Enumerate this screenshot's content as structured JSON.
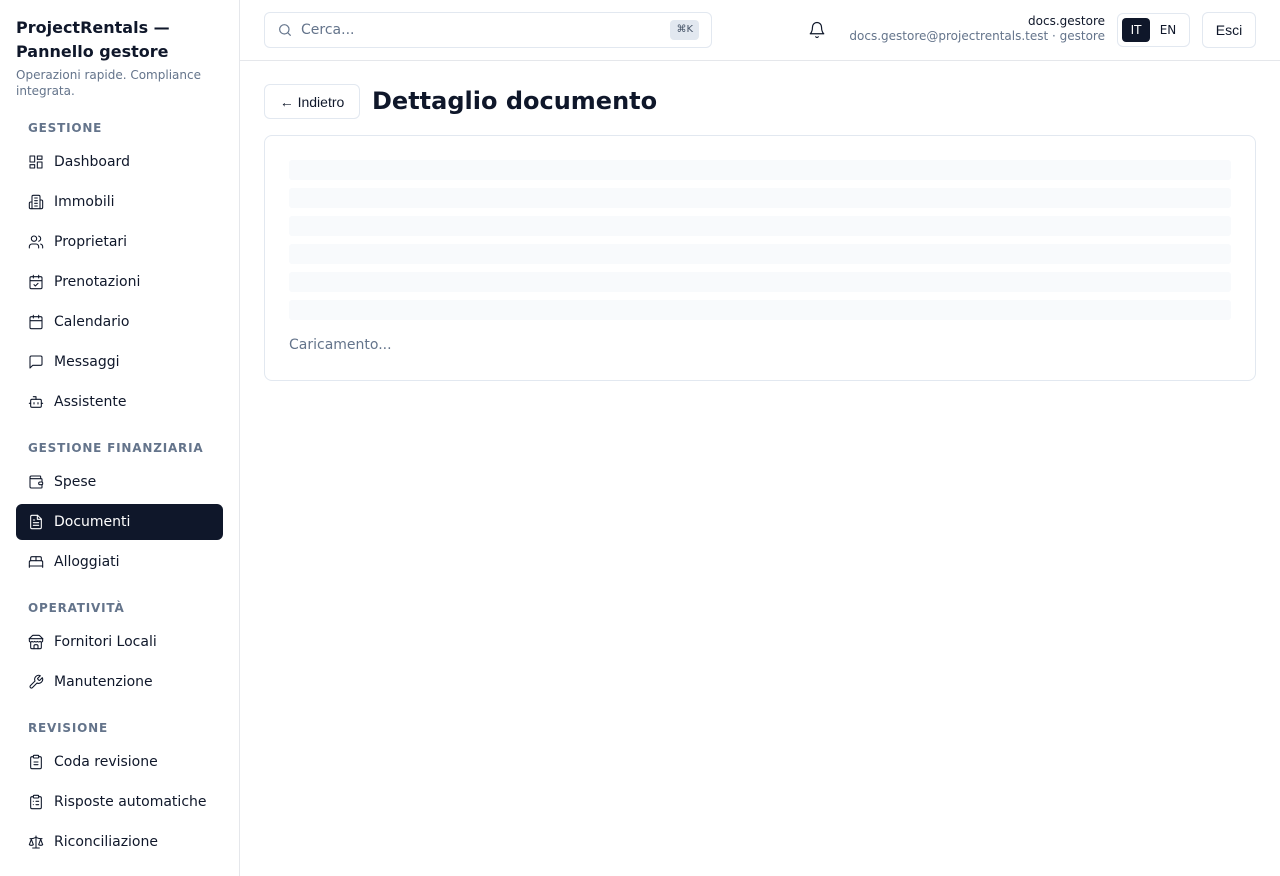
{
  "brand": {
    "title": "ProjectRentals — Pannello gestore",
    "subtitle": "Operazioni rapide. Compliance integrata."
  },
  "sidebar": {
    "sections": [
      {
        "label": "GESTIONE",
        "items": [
          {
            "label": "Dashboard",
            "icon": "dashboard-icon"
          },
          {
            "label": "Immobili",
            "icon": "building-icon"
          },
          {
            "label": "Proprietari",
            "icon": "users-icon"
          },
          {
            "label": "Prenotazioni",
            "icon": "calendar-check-icon"
          },
          {
            "label": "Calendario",
            "icon": "calendar-icon"
          },
          {
            "label": "Messaggi",
            "icon": "message-icon"
          },
          {
            "label": "Assistente",
            "icon": "bot-icon"
          }
        ]
      },
      {
        "label": "GESTIONE FINANZIARIA",
        "items": [
          {
            "label": "Spese",
            "icon": "wallet-icon"
          },
          {
            "label": "Documenti",
            "icon": "document-icon",
            "active": true
          },
          {
            "label": "Alloggiati",
            "icon": "bed-icon"
          }
        ]
      },
      {
        "label": "OPERATIVITÀ",
        "items": [
          {
            "label": "Fornitori Locali",
            "icon": "store-icon"
          },
          {
            "label": "Manutenzione",
            "icon": "wrench-icon"
          }
        ]
      },
      {
        "label": "REVISIONE",
        "items": [
          {
            "label": "Coda revisione",
            "icon": "clipboard-icon"
          },
          {
            "label": "Risposte automatiche",
            "icon": "clipboard-list-icon"
          },
          {
            "label": "Riconciliazione",
            "icon": "scale-icon"
          }
        ]
      }
    ]
  },
  "topbar": {
    "search_placeholder": "Cerca...",
    "search_shortcut": "⌘K",
    "user_name": "docs.gestore",
    "user_email": "docs.gestore@projectrentals.test · gestore",
    "lang_it": "IT",
    "lang_en": "EN",
    "lang_active": "IT",
    "logout_label": "Esci"
  },
  "main": {
    "back_label": "← Indietro",
    "title": "Dettaglio documento",
    "loading_text": "Caricamento..."
  },
  "colors": {
    "accent": "#0f172a",
    "muted_text": "#64748b",
    "border": "#e2e8f0",
    "skeleton": "#f8fafc"
  }
}
